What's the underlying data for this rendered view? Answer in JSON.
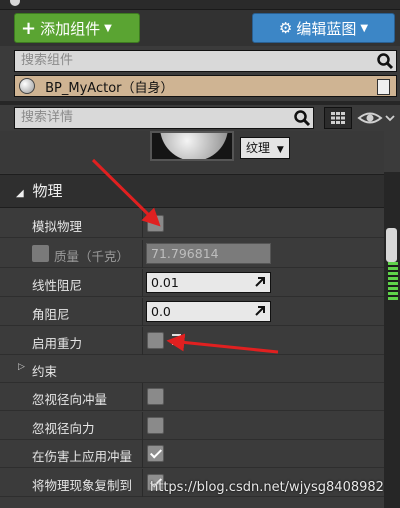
{
  "toolbar": {
    "add_component_label": "添加组件",
    "edit_blueprint_label": "编辑蓝图"
  },
  "components": {
    "search_placeholder": "搜索组件",
    "actor_label": "BP_MyActor（自身）"
  },
  "details": {
    "search_placeholder": "搜索详情",
    "texture_dropdown_label": "纹理"
  },
  "physics": {
    "section_title": "物理",
    "rows": [
      {
        "label": "模拟物理",
        "checked": false
      },
      {
        "label": "质量（千克）",
        "value": "71.796814"
      },
      {
        "label": "线性阻尼",
        "value": "0.01"
      },
      {
        "label": "角阻尼",
        "value": "0.0"
      },
      {
        "label": "启用重力",
        "checked": false
      },
      {
        "label": "约束"
      },
      {
        "label": "忽视径向冲量",
        "checked": false
      },
      {
        "label": "忽视径向力",
        "checked": false
      },
      {
        "label": "在伤害上应用冲量",
        "checked": true
      },
      {
        "label": "将物理现象复制到",
        "checked": true
      }
    ]
  },
  "watermark": "https://blog.csdn.net/wjysg8408982",
  "colors": {
    "add_button": "#5aa432",
    "blueprint_button": "#3c86c6",
    "actor_row": "#cfb493",
    "annotation_arrow": "#e02020"
  }
}
